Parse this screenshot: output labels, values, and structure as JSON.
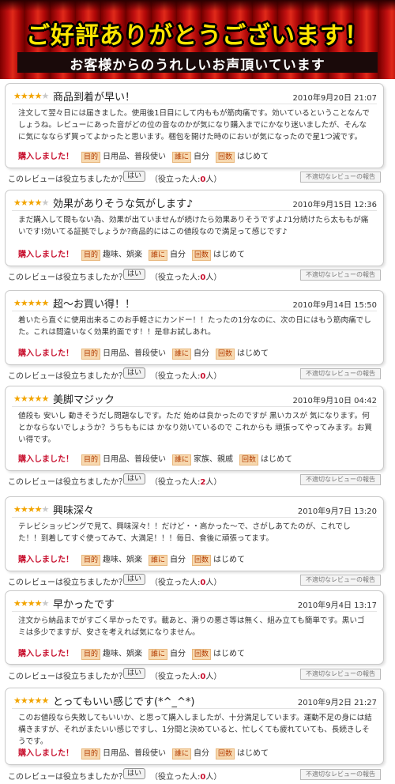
{
  "banner": {
    "title": "ご好評ありがとうございます！",
    "subtitle": "お客様からのうれしいお声頂いています"
  },
  "labels": {
    "purchased": "購入しました！",
    "purpose": "目的",
    "recipient": "誰に",
    "frequency": "回数",
    "helpful_question": "このレビューは役立ちましたか？",
    "yes_button": "はい",
    "helpful_prefix": "（役立った人:",
    "helpful_suffix": "人）",
    "report_button": "不適切なレビューの報告"
  },
  "reviews": [
    {
      "stars": 4,
      "title": "商品到着が早い！",
      "date": "2010年9月20日 21:07",
      "body": "注文して翌々日には届きました。使用後1日目にして内ももが筋肉痛です。効いているということなんでしょうね。レビューにあった音がどの位の音なのかが気になり購入までにかなり迷いましたが、そんなに気になならず買ってよかったと思います。梱包を開けた時のにおいが気になったので星1つ減です。",
      "purpose": "日用品、普段使い",
      "recipient": "自分",
      "frequency": "はじめて",
      "helpful": "0"
    },
    {
      "stars": 4,
      "title": "効果がありそうな気がします♪",
      "date": "2010年9月15日 12:36",
      "body": "まだ購入して間もない為、効果が出ていませんが続けたら効果ありそうですよ♪1分続けたら太ももが痛いです!効いてる証拠でしょうか?商品的にはこの値段なので満足って感じです♪",
      "purpose": "趣味、娯楽",
      "recipient": "自分",
      "frequency": "はじめて",
      "helpful": "0"
    },
    {
      "stars": 5,
      "title": "超～お買い得！！",
      "date": "2010年9月14日 15:50",
      "body": "着いたら直ぐに使用出来るこのお手軽さにカンドー！！たったの1分なのに、次の日にはもう筋肉痛でした。これは間違いなく効果的面です！！是非お試しあれ。",
      "purpose": "日用品、普段使い",
      "recipient": "自分",
      "frequency": "はじめて",
      "helpful": "0"
    },
    {
      "stars": 5,
      "title": "美脚マジック",
      "date": "2010年9月10日 04:42",
      "body": "値段も 安いし 動きそうだし問題なしです。ただ 始めは良かったのですが 黒いカスが 気になります。何とかならないでしょうか？うちももには かなり効いているので これからも 頑張ってやってみます。お買い得です。",
      "purpose": "日用品、普段使い",
      "recipient": "家族、親戚",
      "frequency": "はじめて",
      "helpful": "2"
    },
    {
      "stars": 4,
      "title": "興味深々",
      "date": "2010年9月7日 13:20",
      "body": "テレビショッピングで見て、興味深々！！だけど・・高かった～で、さがしあてたのが、これでした！！到着してすぐ使ってみて、大満足！！！毎日、食後に頑張ってます。",
      "purpose": "趣味、娯楽",
      "recipient": "自分",
      "frequency": "はじめて",
      "helpful": "0"
    },
    {
      "stars": 4,
      "title": "早かったです",
      "date": "2010年9月4日 13:17",
      "body": "注文から納品までがすごく早かったです。載あと、滑りの悪さ等は無く、組み立ても簡単です。黒いゴミは多少でますが、安さを考えれば気になりません。",
      "purpose": "趣味、娯楽",
      "recipient": "自分",
      "frequency": "はじめて",
      "helpful": "0"
    },
    {
      "stars": 5,
      "title": "とってもいい感じです(*^_^*)",
      "date": "2010年9月2日 21:27",
      "body": "このお値段なら失敗してもいいか、と思って購入しましたが、十分満足しています。運動不足の身には結構きますが、それがまたいい感じですし、1分間と決めていると、忙しくても疲れていても、長続きしそうです。",
      "purpose": "日用品、普段使い",
      "recipient": "自分",
      "frequency": "はじめて",
      "helpful": "0"
    }
  ]
}
